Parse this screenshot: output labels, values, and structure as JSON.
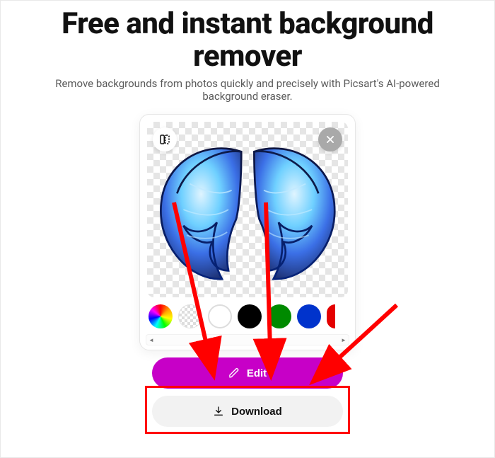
{
  "header": {
    "title": "Free and instant background remover",
    "subtitle": "Remove backgrounds from photos quickly and precisely with Picsart's AI-powered background eraser."
  },
  "preview": {
    "compare_icon": "compare-icon",
    "close_icon": "close-icon"
  },
  "swatches": [
    {
      "name": "color-picker",
      "type": "rainbow"
    },
    {
      "name": "transparent",
      "type": "transparent"
    },
    {
      "name": "white",
      "type": "white",
      "color": "#ffffff"
    },
    {
      "name": "black",
      "type": "solid",
      "color": "#000000"
    },
    {
      "name": "green",
      "type": "solid",
      "color": "#008a00"
    },
    {
      "name": "blue",
      "type": "solid",
      "color": "#0033cc"
    },
    {
      "name": "red",
      "type": "solid",
      "color": "#e40000"
    }
  ],
  "buttons": {
    "edit_label": "Edit",
    "download_label": "Download"
  }
}
